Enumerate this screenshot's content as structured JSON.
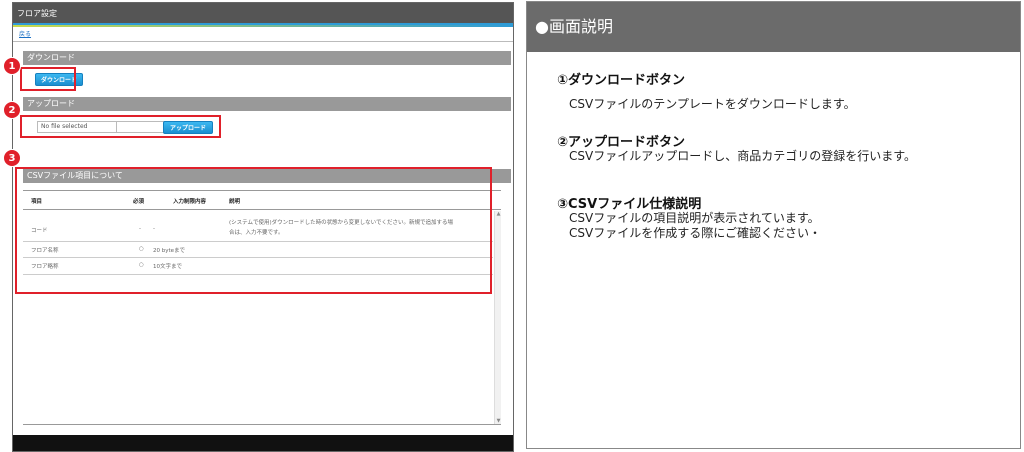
{
  "app": {
    "title": "フロア設定",
    "back_link": "戻る",
    "download_section": "ダウンロード",
    "download_button": "ダウンロード",
    "upload_section": "アップロード",
    "file_placeholder": "No file selected",
    "upload_button": "アップロード",
    "csv_section": "CSVファイル項目について",
    "table": {
      "headers": [
        "項目",
        "必須",
        "入力制限内容",
        "説明"
      ],
      "rows": [
        {
          "item": "コード",
          "required": "-",
          "limit": "-",
          "desc_line1": "(システムで使用)ダウンロードした時の状態から変更しないでください。新規で追加する場",
          "desc_line2": "合は、入力不要です。"
        },
        {
          "item": "フロア名称",
          "required": "○",
          "limit": "20 byteまで",
          "desc_line1": "",
          "desc_line2": ""
        },
        {
          "item": "フロア略称",
          "required": "○",
          "limit": "10文字まで",
          "desc_line1": "",
          "desc_line2": ""
        }
      ]
    },
    "scroll_up": "▲",
    "scroll_down": "▼"
  },
  "badges": [
    "1",
    "2",
    "3"
  ],
  "panel": {
    "header": "●画面説明",
    "items": [
      {
        "title": "①ダウンロードボタン",
        "desc": [
          "CSVファイルのテンプレートをダウンロードします。"
        ]
      },
      {
        "title": "②アップロードボタン",
        "desc": [
          "CSVファイルアップロードし、商品カテゴリの登録を行います。"
        ]
      },
      {
        "title": "③CSVファイル仕様説明",
        "desc": [
          "CSVファイルの項目説明が表示されています。",
          "CSVファイルを作成する際にご確認ください・"
        ]
      }
    ]
  },
  "colors": {
    "accent_blue": "#2e9bd6",
    "annotation_red": "#e0202a",
    "panel_header": "#6b6b6b"
  }
}
